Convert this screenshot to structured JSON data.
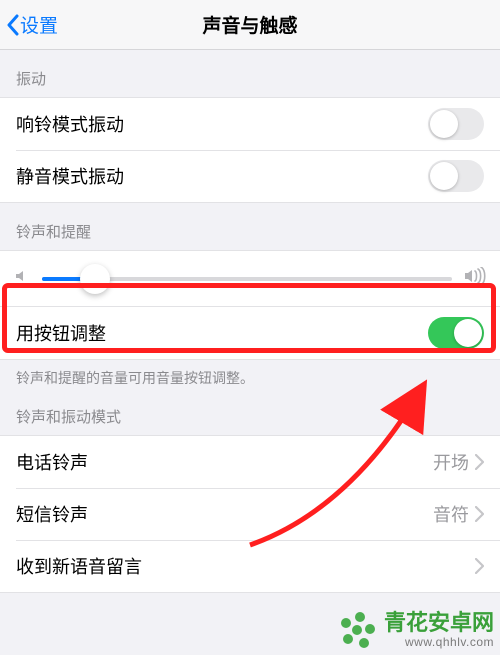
{
  "nav": {
    "back_label": "设置",
    "title": "声音与触感"
  },
  "sections": {
    "vibrate_header": "振动",
    "ring_vibrate_label": "响铃模式振动",
    "silent_vibrate_label": "静音模式振动",
    "rings_header": "铃声和提醒",
    "button_adjust_label": "用按钮调整",
    "rings_footer": "铃声和提醒的音量可用音量按钮调整。",
    "pattern_header": "铃声和振动模式",
    "ringtone_label": "电话铃声",
    "ringtone_value": "开场",
    "sms_label": "短信铃声",
    "sms_value": "音符",
    "voicemail_label": "收到新语音留言"
  },
  "toggles": {
    "ring_vibrate": false,
    "silent_vibrate": false,
    "button_adjust": true
  },
  "slider": {
    "value_pct": 13
  },
  "colors": {
    "accent": "#0a7aff",
    "toggle_on": "#34c759",
    "annotation": "#ff1f1f"
  },
  "watermark": {
    "brand": "青花安卓网",
    "url": "www.qhhlv.com"
  }
}
